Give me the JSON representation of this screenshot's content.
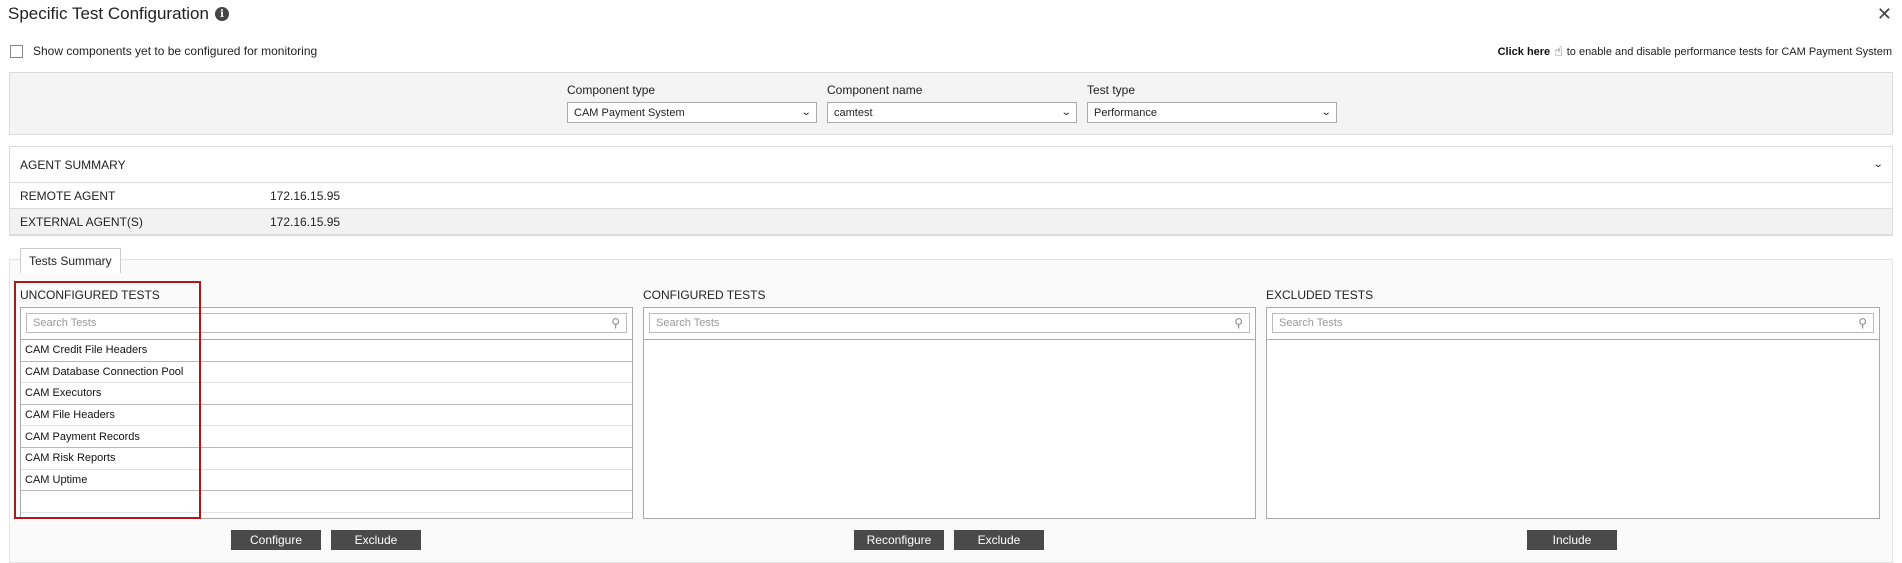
{
  "dialog": {
    "title": "Specific Test Configuration",
    "close_glyph": "✕",
    "info_glyph": "i"
  },
  "show_unconfigured": {
    "label": "Show components yet to be configured for monitoring",
    "checked": false
  },
  "click_here": {
    "link": "Click here",
    "text": "to enable and disable performance tests for CAM Payment System"
  },
  "filters": {
    "component_type": {
      "label": "Component type",
      "value": "CAM Payment System"
    },
    "component_name": {
      "label": "Component name",
      "value": "camtest"
    },
    "test_type": {
      "label": "Test type",
      "value": "Performance"
    }
  },
  "agent_summary": {
    "title": "AGENT SUMMARY",
    "rows": [
      {
        "label": "REMOTE AGENT",
        "value": "172.16.15.95"
      },
      {
        "label": "EXTERNAL AGENT(S)",
        "value": "172.16.15.95"
      }
    ]
  },
  "tests_summary": {
    "tab": "Tests Summary",
    "unconfigured": {
      "title": "UNCONFIGURED TESTS",
      "search_placeholder": "Search Tests",
      "items": [
        "CAM Credit File Headers",
        "CAM Database Connection Pool",
        "CAM Executors",
        "CAM File Headers",
        "CAM Payment Records",
        "CAM Risk Reports",
        "CAM Uptime"
      ],
      "buttons": {
        "configure": "Configure",
        "exclude": "Exclude"
      }
    },
    "configured": {
      "title": "CONFIGURED TESTS",
      "search_placeholder": "Search Tests",
      "items": [],
      "buttons": {
        "reconfigure": "Reconfigure",
        "exclude": "Exclude"
      }
    },
    "excluded": {
      "title": "EXCLUDED TESTS",
      "search_placeholder": "Search Tests",
      "items": [],
      "buttons": {
        "include": "Include"
      }
    }
  },
  "colors": {
    "button_bg": "#4a4a4a",
    "highlight_border": "#b01818",
    "panel_bg": "#f4f4f4"
  }
}
